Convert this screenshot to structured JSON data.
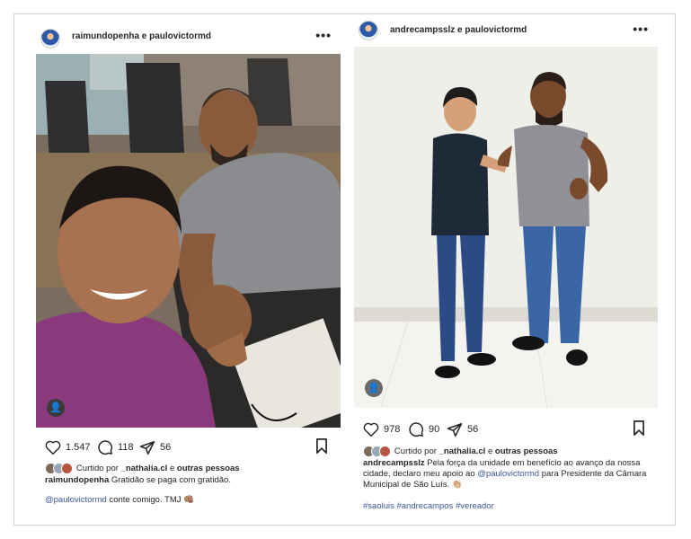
{
  "left_post": {
    "username": "raimundopenha e paulovictormd",
    "more_icon": "•••",
    "likes_count": "1.547",
    "comments_count": "118",
    "shares_count": "56",
    "liked_prefix": "Curtido por",
    "liked_user": "_nathalia.cl",
    "liked_mid": "e",
    "liked_others": "outras pessoas",
    "caption_user": "raimundopenha",
    "caption_text": "Gratidão se paga com gratidão.",
    "comment_mention": "@paulovictormd",
    "comment_text": "conte comigo. TMJ 👊🏽"
  },
  "right_post": {
    "username": "andrecampsslz e paulovictormd",
    "more_icon": "•••",
    "likes_count": "978",
    "comments_count": "90",
    "shares_count": "56",
    "liked_prefix": "Curtido por",
    "liked_user": "_nathalia.cl",
    "liked_mid": "e",
    "liked_others": "outras pessoas",
    "caption_user": "andrecampsslz",
    "caption_text_1": "Pela força da unidade em benefício ao avanço da nossa cidade, declaro meu apoio ao",
    "caption_mention": "@paulovictormd",
    "caption_text_2": "para Presidente da Câmara Municipal de São Luís. 👏🏼",
    "hashtags": "#saoluis #andrecampos #vereador"
  },
  "icons": {
    "more": "more-options-icon",
    "like": "heart-icon",
    "comment": "comment-icon",
    "share": "send-icon",
    "save": "bookmark-icon",
    "tag": "user-tag-icon"
  },
  "colors": {
    "mention": "#385898",
    "text": "#262626"
  }
}
